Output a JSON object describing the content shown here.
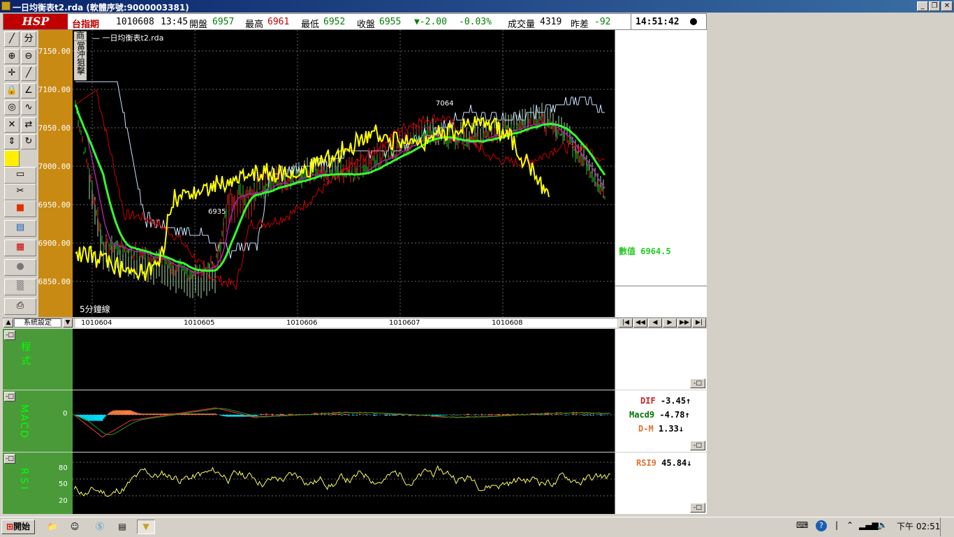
{
  "window": {
    "title": "一日均衡表t2.rda (軟體序號:9000003381)",
    "controls": [
      "_",
      "❐",
      "✕"
    ]
  },
  "quote": {
    "logo": "HSP",
    "symbol": "台指期",
    "date": "1010608",
    "time": "13:45",
    "open_label": "開盤",
    "open": "6957",
    "high_label": "最高",
    "high": "6961",
    "low_label": "最低",
    "low": "6952",
    "close_label": "收盤",
    "close": "6955",
    "change": "▼-2.00",
    "change_pct": "-0.03%",
    "volume_label": "成交量",
    "volume": "4319",
    "diff_label": "昨差",
    "diff": "-92",
    "clock": "14:51:42"
  },
  "toolbar": {
    "items": [
      "line-tool-icon",
      "split-icon",
      "zoom-in-icon",
      "zoom-out-icon",
      "crosshair-icon",
      "pen-icon",
      "lock-icon",
      "angle-icon",
      "target-icon",
      "wave-icon",
      "cross-lines-icon",
      "swap-icon",
      "arrows-icon",
      "refresh-icon",
      "color-icon",
      "folder-icon",
      "scissors-icon",
      "stop-icon",
      "window-icon",
      "grid-icon",
      "group-icon",
      "tools-icon",
      "print-icon"
    ]
  },
  "main_chart": {
    "tabs": [
      "商",
      "當沖狙擊"
    ],
    "study_title": "一日均衡表t2.rda",
    "interval_label": "5分鐘線",
    "annotation_high": "7064",
    "annotation_low": "6935",
    "y_ticks": [
      "7150.00",
      "7100.00",
      "7050.00",
      "7000.00",
      "6950.00",
      "6900.00",
      "6850.00"
    ],
    "value_label": "數值",
    "value": "6964.5",
    "colors": {
      "price_yellow": "#ffff00",
      "green_line": "#33ff33",
      "cloud_red": "#ff3333",
      "cloud_green": "#ccffcc",
      "line_white": "#cce0ff",
      "line_red": "#cc0000",
      "line_purple": "#aa22aa",
      "axis_gold": "#c98a14"
    }
  },
  "date_bar": {
    "system_label": "系統設定",
    "dates": [
      "1010604",
      "1010605",
      "1010606",
      "1010607",
      "1010608"
    ],
    "nav": [
      "|◀",
      "◀◀",
      "◀",
      "▶",
      "▶▶",
      "▶|"
    ]
  },
  "panel_program": {
    "label": "程式"
  },
  "panel_macd": {
    "label": "MACD",
    "zero_label": "0",
    "dif_label": "DIF",
    "dif": "-3.45",
    "dif_arrow": "↑",
    "macd9_label": "Macd9",
    "macd9": "-4.78",
    "macd9_arrow": "↑",
    "dm_label": "D-M",
    "dm": "1.33",
    "dm_arrow": "↓"
  },
  "panel_rsi": {
    "label": "RSI",
    "ticks": [
      "80",
      "50",
      "20"
    ],
    "rsi_label": "RSI9",
    "rsi": "45.84",
    "rsi_arrow": "↓"
  },
  "taskbar": {
    "start": "開始",
    "clock": "下午 02:51"
  }
}
